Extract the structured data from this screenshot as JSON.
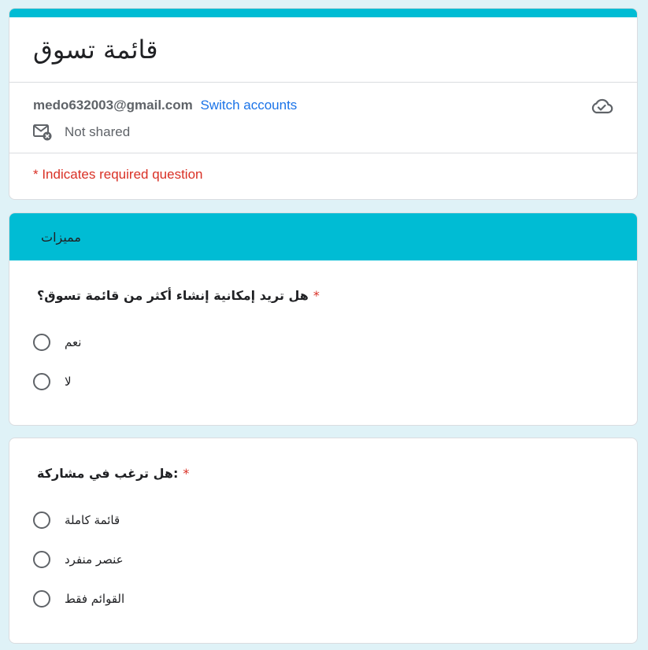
{
  "form": {
    "title": "قائمة تسوق",
    "accent_color": "#00bcd4"
  },
  "account": {
    "email": "medo632003@gmail.com",
    "switch_label": "Switch accounts",
    "share_status": "Not shared",
    "sync_icon": "cloud-check-icon",
    "share_icon": "mail-not-shared-icon"
  },
  "required_note": "* Indicates required question",
  "section": {
    "title": "مميزات"
  },
  "questions": [
    {
      "text": "هل تريد إمكانية إنشاء أكثر من قائمة تسوق؟",
      "required_mark": "*",
      "options": [
        "نعم",
        "لا"
      ]
    },
    {
      "text": "هل ترغب في مشاركة:",
      "required_mark": "*",
      "options": [
        "قائمة كاملة",
        "عنصر منفرد",
        "القوائم فقط"
      ]
    }
  ]
}
